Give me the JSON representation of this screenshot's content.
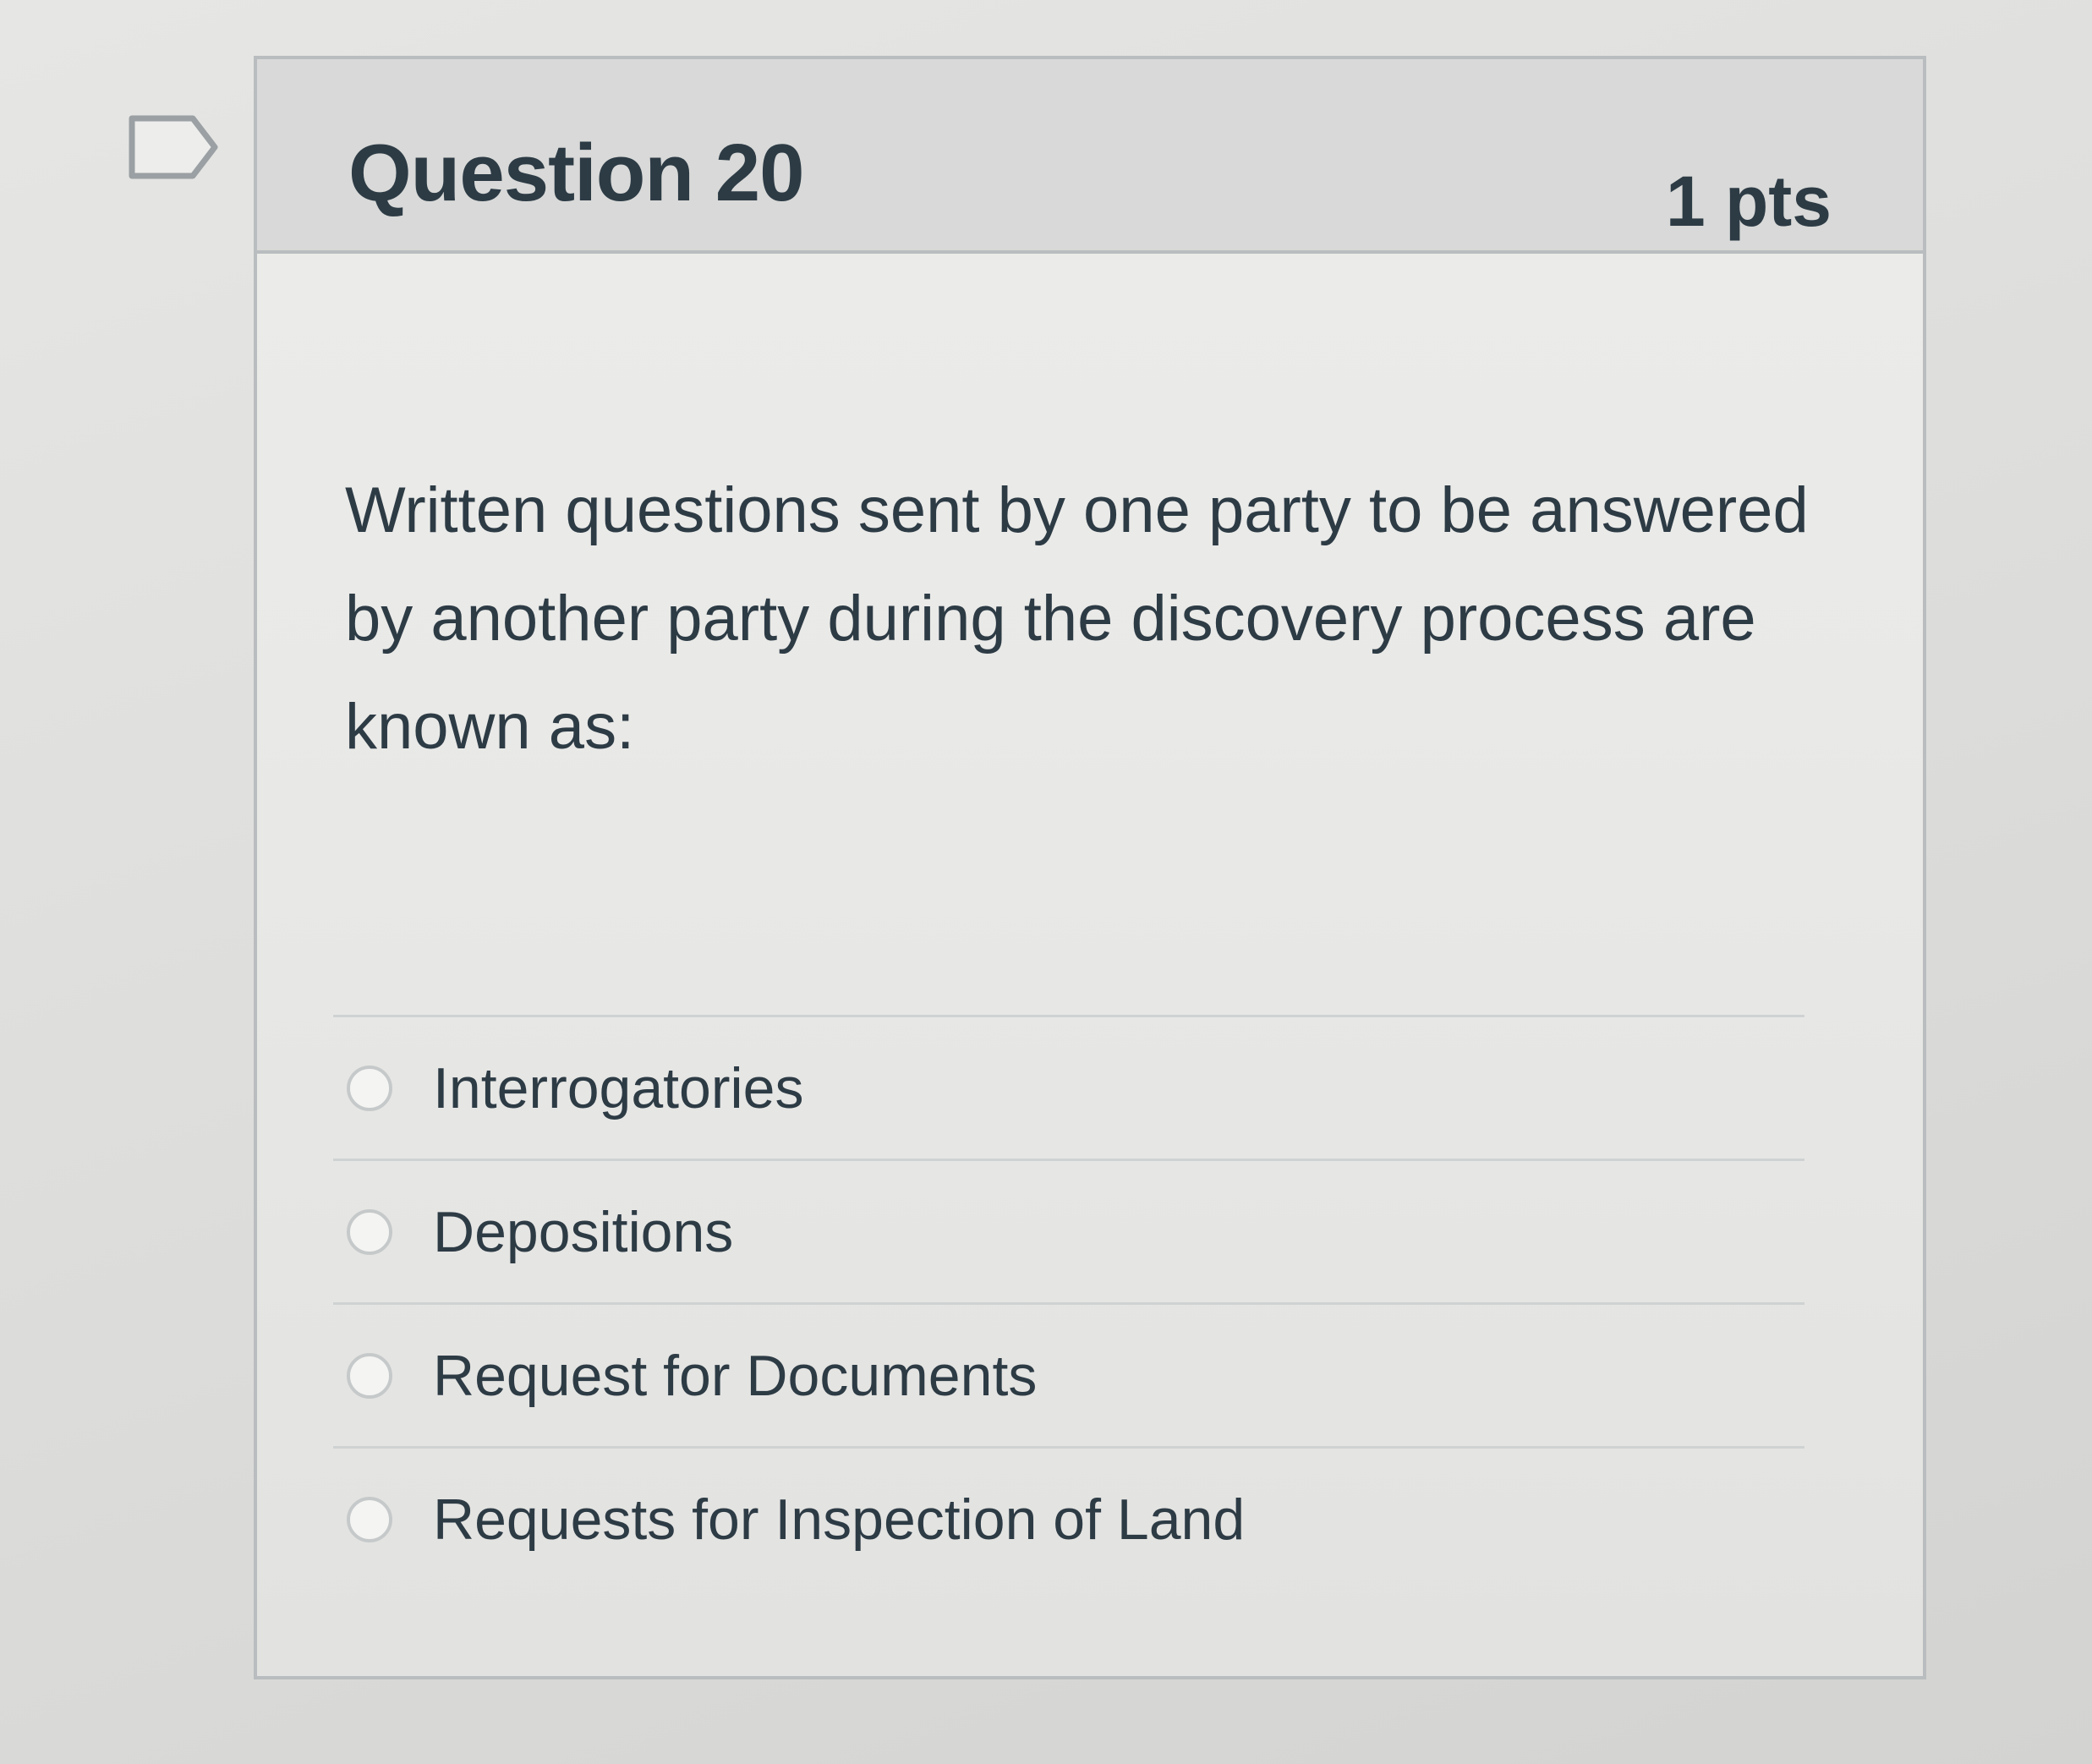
{
  "question": {
    "title": "Question 20",
    "points": "1 pts",
    "text": "Written questions sent by one party to be answered by another party during the discovery process are known as:"
  },
  "answers": [
    {
      "label": "Interrogatories",
      "selected": false
    },
    {
      "label": "Depositions",
      "selected": false
    },
    {
      "label": "Request for Documents",
      "selected": false
    },
    {
      "label": "Requests for Inspection of Land",
      "selected": false
    }
  ],
  "icons": {
    "flag": "flag-question-icon",
    "radio": "radio-unselected-icon"
  },
  "colors": {
    "text": "#2d3b45",
    "header_bg": "#d8d9d8",
    "border": "#b9bdbf"
  }
}
